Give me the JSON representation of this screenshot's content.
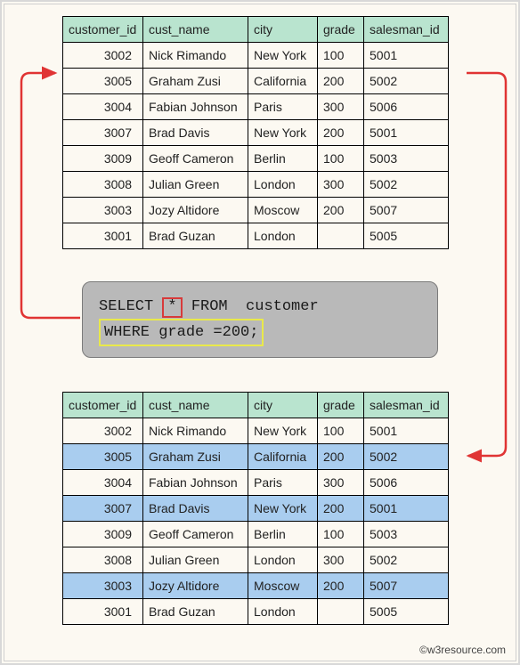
{
  "columns": {
    "customer_id": "customer_id",
    "cust_name": "cust_name",
    "city": "city",
    "grade": "grade",
    "salesman_id": "salesman_id"
  },
  "top_rows": [
    {
      "customer_id": "3002",
      "cust_name": "Nick Rimando",
      "city": "New York",
      "grade": "100",
      "salesman_id": "5001"
    },
    {
      "customer_id": "3005",
      "cust_name": "Graham Zusi",
      "city": "California",
      "grade": "200",
      "salesman_id": "5002"
    },
    {
      "customer_id": "3004",
      "cust_name": "Fabian Johnson",
      "city": "Paris",
      "grade": "300",
      "salesman_id": "5006"
    },
    {
      "customer_id": "3007",
      "cust_name": "Brad Davis",
      "city": "New York",
      "grade": "200",
      "salesman_id": "5001"
    },
    {
      "customer_id": "3009",
      "cust_name": "Geoff Cameron",
      "city": "Berlin",
      "grade": "100",
      "salesman_id": "5003"
    },
    {
      "customer_id": "3008",
      "cust_name": "Julian Green",
      "city": "London",
      "grade": "300",
      "salesman_id": "5002"
    },
    {
      "customer_id": "3003",
      "cust_name": "Jozy Altidore",
      "city": "Moscow",
      "grade": "200",
      "salesman_id": "5007"
    },
    {
      "customer_id": "3001",
      "cust_name": "Brad Guzan",
      "city": "London",
      "grade": "",
      "salesman_id": "5005"
    }
  ],
  "bottom_rows": [
    {
      "customer_id": "3002",
      "cust_name": "Nick Rimando",
      "city": "New York",
      "grade": "100",
      "salesman_id": "5001",
      "hl": false
    },
    {
      "customer_id": "3005",
      "cust_name": "Graham Zusi",
      "city": "California",
      "grade": "200",
      "salesman_id": "5002",
      "hl": true
    },
    {
      "customer_id": "3004",
      "cust_name": "Fabian Johnson",
      "city": "Paris",
      "grade": "300",
      "salesman_id": "5006",
      "hl": false
    },
    {
      "customer_id": "3007",
      "cust_name": "Brad Davis",
      "city": "New York",
      "grade": "200",
      "salesman_id": "5001",
      "hl": true
    },
    {
      "customer_id": "3009",
      "cust_name": "Geoff Cameron",
      "city": "Berlin",
      "grade": "100",
      "salesman_id": "5003",
      "hl": false
    },
    {
      "customer_id": "3008",
      "cust_name": "Julian Green",
      "city": "London",
      "grade": "300",
      "salesman_id": "5002",
      "hl": false
    },
    {
      "customer_id": "3003",
      "cust_name": "Jozy Altidore",
      "city": "Moscow",
      "grade": "200",
      "salesman_id": "5007",
      "hl": true
    },
    {
      "customer_id": "3001",
      "cust_name": "Brad Guzan",
      "city": "London",
      "grade": "",
      "salesman_id": "5005",
      "hl": false
    }
  ],
  "sql": {
    "select_kw": "SELECT",
    "star": "*",
    "from_kw": "FROM",
    "table": "customer",
    "where_clause": "WHERE grade =200;"
  },
  "copyright": "©w3resource.com",
  "colors": {
    "header_bg": "#b9e4cf",
    "highlight_bg": "#a9cdef",
    "arrow": "#e03434"
  }
}
